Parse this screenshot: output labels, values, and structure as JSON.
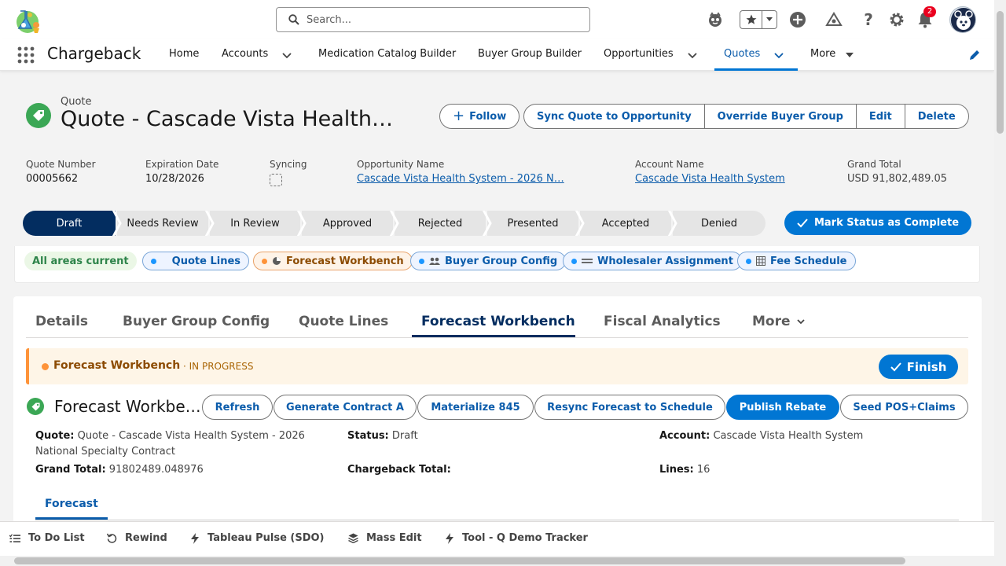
{
  "header": {
    "search_placeholder": "Search...",
    "notification_count": "2",
    "icons": [
      "salesforce-logo-icon",
      "einstein-icon",
      "favorite-star-icon",
      "add-icon",
      "trailhead-icon",
      "help-icon",
      "setup-gear-icon",
      "bell-icon",
      "user-avatar-icon"
    ]
  },
  "nav": {
    "app_name": "Chargeback",
    "items": [
      {
        "label": "Home"
      },
      {
        "label": "Accounts"
      },
      {
        "label": "Medication Catalog Builder"
      },
      {
        "label": "Buyer Group Builder"
      },
      {
        "label": "Opportunities"
      },
      {
        "label": "Quotes"
      },
      {
        "label": "More"
      }
    ],
    "active": "Quotes"
  },
  "record": {
    "object_label": "Quote",
    "title": "Quote - Cascade Vista Health…",
    "actions": {
      "follow": "Follow",
      "sync": "Sync Quote to Opportunity",
      "override": "Override Buyer Group",
      "edit": "Edit",
      "delete": "Delete"
    },
    "fields": [
      {
        "label": "Quote Number",
        "value": "00005662"
      },
      {
        "label": "Expiration Date",
        "value": "10/28/2026"
      },
      {
        "label": "Syncing",
        "value": ""
      },
      {
        "label": "Opportunity Name",
        "value": "Cascade Vista Health System - 2026 N…"
      },
      {
        "label": "Account Name",
        "value": "Cascade Vista Health System"
      },
      {
        "label": "Grand Total",
        "value": "USD 91,802,489.05"
      }
    ]
  },
  "path": {
    "stages": [
      "Draft",
      "Needs Review",
      "In Review",
      "Approved",
      "Rejected",
      "Presented",
      "Accepted",
      "Denied"
    ],
    "current": "Draft",
    "mark_complete": "Mark Status as Complete"
  },
  "areas": {
    "status": "All areas current",
    "chips": [
      "Quote Lines",
      "Forecast Workbench",
      "Buyer Group Config",
      "Wholesaler Assignment",
      "Fee Schedule"
    ]
  },
  "tabs": {
    "items": [
      "Details",
      "Buyer Group Config",
      "Quote Lines",
      "Forecast Workbench",
      "Fiscal Analytics",
      "More"
    ],
    "active": "Forecast Workbench"
  },
  "banner": {
    "title": "Forecast Workbench",
    "state": "· IN PROGRESS",
    "finish": "Finish"
  },
  "workbench": {
    "title": "Forecast Workbe…",
    "buttons": [
      "Refresh",
      "Generate Contract A",
      "Materialize 845",
      "Resync Forecast to Schedule",
      "Publish Rebate",
      "Seed POS+Claims"
    ],
    "info": {
      "quote_label": "Quote:",
      "quote_value": "Quote - Cascade Vista Health System - 2026 National Specialty Contract",
      "status_label": "Status:",
      "status_value": "Draft",
      "account_label": "Account:",
      "account_value": "Cascade Vista Health System",
      "grand_total_label": "Grand Total:",
      "grand_total_value": "91802489.048976",
      "chargeback_label": "Chargeback Total:",
      "chargeback_value": "",
      "lines_label": "Lines:",
      "lines_value": "16"
    },
    "subtab": "Forecast"
  },
  "utility_bar": [
    "To Do List",
    "Rewind",
    "Tableau Pulse (SDO)",
    "Mass Edit",
    "Tool - Q Demo Tracker"
  ],
  "colors": {
    "brand": "#0176d3",
    "path_current": "#032d60",
    "warning": "#fe9339",
    "success": "#2e844a"
  }
}
